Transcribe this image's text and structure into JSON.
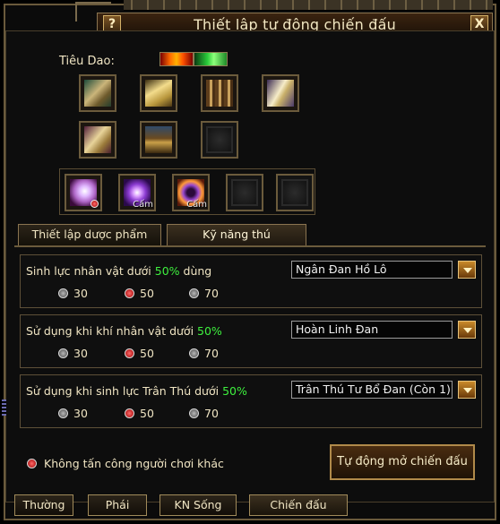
{
  "window": {
    "title": "Thiết lập tự động chiến đấu",
    "help_label": "?",
    "close_label": "X"
  },
  "tieu_dao_label": "Tiêu Dao:",
  "items": [
    {
      "icon": "scroll-icon"
    },
    {
      "icon": "book-icon"
    },
    {
      "icon": "map-icon"
    },
    {
      "icon": "scroll-icon"
    },
    {
      "icon": "scroll-icon"
    },
    {
      "icon": "chest-icon"
    },
    {
      "icon": "empty-slot"
    }
  ],
  "skills": [
    {
      "icon": "feather-skill-icon",
      "badge": ""
    },
    {
      "icon": "burst-skill-icon",
      "badge": "Cấm"
    },
    {
      "icon": "orb-skill-icon",
      "badge": "Cấm"
    },
    {
      "icon": "empty-slot",
      "badge": ""
    },
    {
      "icon": "empty-slot",
      "badge": ""
    }
  ],
  "tabs": [
    {
      "label": "Thiết lập dược phẩm"
    },
    {
      "label": "Kỹ năng thú"
    }
  ],
  "rows": [
    {
      "label_prefix": "Sinh lực nhân vật dưới ",
      "percent": "50%",
      "label_suffix": " dùng",
      "options": [
        "30",
        "50",
        "70"
      ],
      "selected": "50",
      "select_value": "Ngân Đan Hồ Lô"
    },
    {
      "label_prefix": "Sử dụng khi khí nhân vật dưới ",
      "percent": "50%",
      "label_suffix": "",
      "options": [
        "30",
        "50",
        "70"
      ],
      "selected": "50",
      "select_value": "Hoàn Linh Đan"
    },
    {
      "label_prefix": "Sử dụng khi sinh lực Trân Thú dưới ",
      "percent": "50%",
      "label_suffix": "",
      "options": [
        "30",
        "50",
        "70"
      ],
      "selected": "50",
      "select_value": "Trân Thú Tư Bổ Đan (Còn 1)"
    }
  ],
  "no_attack_label": "Không tấn công người chơi khác",
  "auto_button_label": "Tự động mở chiến đấu",
  "bottom_tabs": [
    {
      "label": "Thường"
    },
    {
      "label": "Phái"
    },
    {
      "label": "KN Sống"
    },
    {
      "label": "Chiến đấu"
    }
  ],
  "colors": {
    "accent_gold": "#8a7450",
    "percent_green": "#3ef03e",
    "radio_on": "#c00000"
  }
}
